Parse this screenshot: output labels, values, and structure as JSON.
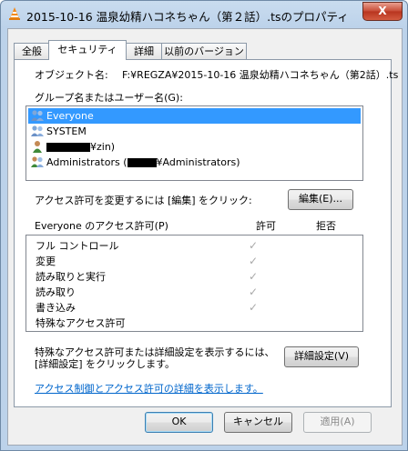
{
  "window": {
    "title": "2015-10-16 温泉幼精ハコネちゃん（第２話）.tsのプロパティ",
    "close_label": "X"
  },
  "tabs": [
    {
      "label": "全般"
    },
    {
      "label": "セキュリティ"
    },
    {
      "label": "詳細"
    },
    {
      "label": "以前のバージョン"
    }
  ],
  "object": {
    "label": "オブジェクト名:",
    "value": "F:¥REGZA¥2015-10-16 温泉幼精ハコネちゃん（第2話）.ts"
  },
  "groups": {
    "label": "グループ名またはユーザー名(G):",
    "items": [
      {
        "label": "Everyone"
      },
      {
        "label": "SYSTEM"
      },
      {
        "prefix": "",
        "suffix": "¥zin)"
      },
      {
        "prefix": "Administrators (",
        "suffix": "¥Administrators)"
      }
    ]
  },
  "change": {
    "text": "アクセス許可を変更するには [編集] をクリック:",
    "edit_button": "編集(E)..."
  },
  "permissions": {
    "header": "Everyone のアクセス許可(P)",
    "allow_header": "許可",
    "deny_header": "拒否",
    "check_glyph": "✓",
    "rows": [
      {
        "name": "フル コントロール"
      },
      {
        "name": "変更"
      },
      {
        "name": "読み取りと実行"
      },
      {
        "name": "読み取り"
      },
      {
        "name": "書き込み"
      },
      {
        "name": "特殊なアクセス許可"
      }
    ]
  },
  "advanced": {
    "text_line1": "特殊なアクセス許可または詳細設定を表示するには、",
    "text_line2": "[詳細設定] をクリックします。",
    "button": "詳細設定(V)"
  },
  "link": {
    "text": "アクセス制御とアクセス許可の詳細を表示します。"
  },
  "footer": {
    "ok": "OK",
    "cancel": "キャンセル",
    "apply": "適用(A)"
  },
  "colors": {
    "selection": "#3399ff",
    "link": "#0066cc",
    "close": "#c74a34"
  }
}
